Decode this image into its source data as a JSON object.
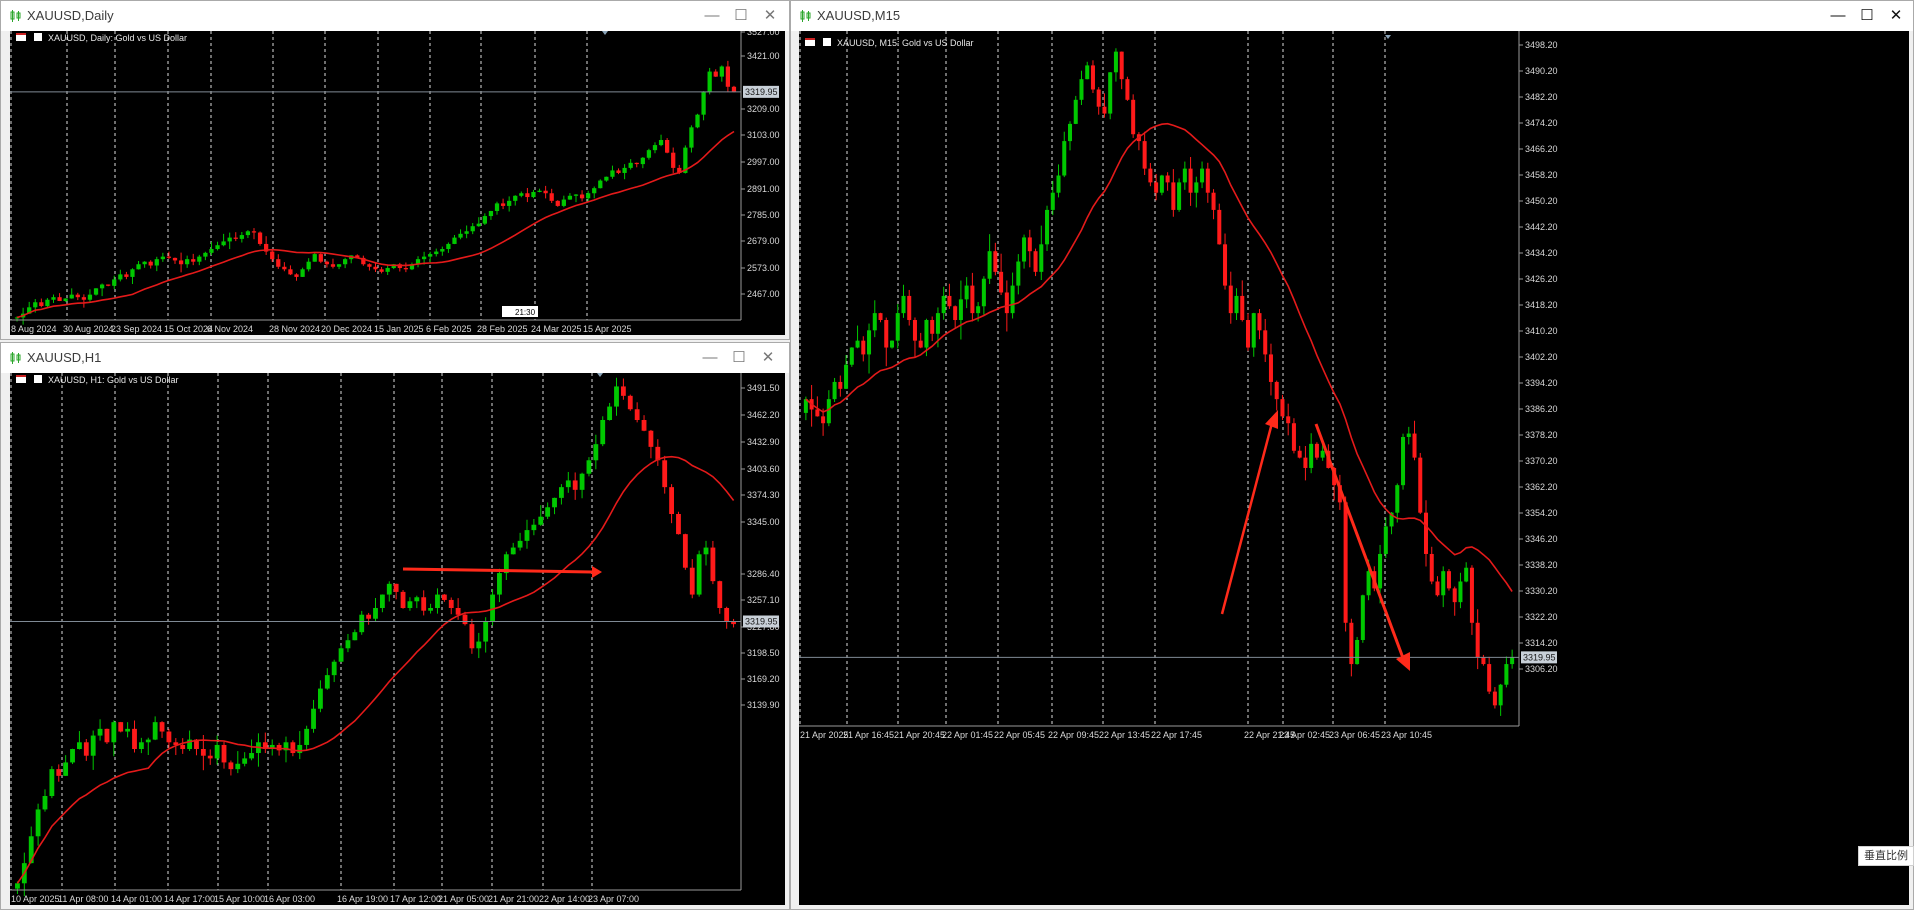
{
  "colors": {
    "up": "#00c800",
    "down": "#ff1a1a",
    "ma": "#e41a1a",
    "grid": "#dddddd",
    "axis": "#9a9a9a",
    "arrow": "#ff2a1a",
    "bid_line": "#7f8a95"
  },
  "windows": {
    "daily": {
      "title": "XAUUSD,Daily",
      "chart_label": "XAUUSD, Daily:  Gold vs US Dollar",
      "price_ticks": [
        "3527.00",
        "3421.00",
        "3209.00",
        "3103.00",
        "2997.00",
        "2891.00",
        "2785.00",
        "2679.00",
        "2573.00",
        "2467.00"
      ],
      "current_price": "3319.95",
      "time_labels": [
        "8 Aug 2024",
        "30 Aug 2024",
        "23 Sep 2024",
        "15 Oct 2024",
        "6 Nov 2024",
        "28 Nov 2024",
        "20 Dec 2024",
        "15 Jan 2025",
        "6 Feb 2025",
        "28 Feb 2025",
        "24 Mar 2025",
        "15 Apr 2025"
      ],
      "countdown": "21:30"
    },
    "h1": {
      "title": "XAUUSD,H1",
      "chart_label": "XAUUSD, H1:  Gold vs US Dollar",
      "price_ticks": [
        "3491.50",
        "3462.20",
        "3432.90",
        "3403.60",
        "3374.30",
        "3345.00",
        "3286.40",
        "3257.10",
        "3227.80",
        "3198.50",
        "3169.20",
        "3139.90"
      ],
      "current_price": "3319.95",
      "time_labels": [
        "10 Apr 2025",
        "11 Apr 08:00",
        "14 Apr 01:00",
        "14 Apr 17:00",
        "15 Apr 10:00",
        "16 Apr 03:00",
        "16 Apr 19:00",
        "17 Apr 12:00",
        "21 Apr 05:00",
        "21 Apr 21:00",
        "22 Apr 14:00",
        "23 Apr 07:00"
      ]
    },
    "m15": {
      "title": "XAUUSD,M15",
      "chart_label": "XAUUSD, M15:  Gold vs US Dollar",
      "price_ticks": [
        "3498.20",
        "3490.20",
        "3482.20",
        "3474.20",
        "3466.20",
        "3458.20",
        "3450.20",
        "3442.20",
        "3434.20",
        "3426.20",
        "3418.20",
        "3410.20",
        "3402.20",
        "3394.20",
        "3386.20",
        "3378.20",
        "3370.20",
        "3362.20",
        "3354.20",
        "3346.20",
        "3338.20",
        "3330.20",
        "3322.20",
        "3314.20",
        "3306.20"
      ],
      "current_price": "3319.95",
      "time_labels": [
        "21 Apr 2025",
        "21 Apr 16:45",
        "21 Apr 20:45",
        "22 Apr 01:45",
        "22 Apr 05:45",
        "22 Apr 09:45",
        "22 Apr 13:45",
        "22 Apr 17:45",
        "22 Apr 21:45",
        "23 Apr 02:45",
        "23 Apr 06:45",
        "23 Apr 10:45"
      ],
      "scale_button": "垂直比例"
    }
  },
  "series": {
    "daily": {
      "ylim": [
        2420,
        3560
      ],
      "ma_period": 20,
      "closes": [
        2430,
        2445,
        2470,
        2490,
        2475,
        2500,
        2510,
        2495,
        2505,
        2520,
        2510,
        2500,
        2520,
        2545,
        2560,
        2555,
        2580,
        2600,
        2590,
        2620,
        2640,
        2650,
        2635,
        2660,
        2670,
        2665,
        2655,
        2640,
        2660,
        2650,
        2670,
        2685,
        2700,
        2715,
        2730,
        2745,
        2740,
        2755,
        2770,
        2765,
        2720,
        2690,
        2660,
        2630,
        2620,
        2600,
        2590,
        2620,
        2650,
        2680,
        2650,
        2640,
        2630,
        2640,
        2660,
        2675,
        2665,
        2640,
        2630,
        2620,
        2610,
        2625,
        2640,
        2625,
        2620,
        2640,
        2660,
        2670,
        2680,
        2690,
        2700,
        2720,
        2745,
        2760,
        2770,
        2790,
        2800,
        2830,
        2850,
        2880,
        2870,
        2890,
        2910,
        2920,
        2905,
        2925,
        2930,
        2920,
        2890,
        2870,
        2895,
        2910,
        2915,
        2900,
        2920,
        2940,
        2970,
        2985,
        3010,
        3000,
        3020,
        3040,
        3035,
        3060,
        3090,
        3110,
        3130,
        3080,
        3020,
        3000,
        3100,
        3180,
        3230,
        3320,
        3400,
        3380,
        3420,
        3340,
        3320
      ]
    },
    "h1": {
      "ylim": [
        3120,
        3505
      ],
      "ma_period": 20,
      "closes": [
        3125,
        3140,
        3160,
        3180,
        3190,
        3210,
        3205,
        3215,
        3225,
        3230,
        3220,
        3235,
        3240,
        3230,
        3245,
        3238,
        3240,
        3225,
        3230,
        3232,
        3245,
        3238,
        3230,
        3228,
        3225,
        3232,
        3225,
        3220,
        3218,
        3228,
        3215,
        3210,
        3214,
        3218,
        3222,
        3230,
        3225,
        3228,
        3224,
        3230,
        3222,
        3228,
        3240,
        3255,
        3270,
        3280,
        3290,
        3300,
        3306,
        3312,
        3325,
        3322,
        3330,
        3340,
        3348,
        3342,
        3330,
        3335,
        3338,
        3328,
        3330,
        3340,
        3336,
        3330,
        3325,
        3318,
        3300,
        3305,
        3320,
        3340,
        3356,
        3370,
        3375,
        3380,
        3388,
        3392,
        3398,
        3405,
        3412,
        3420,
        3425,
        3418,
        3430,
        3440,
        3452,
        3470,
        3480,
        3495,
        3488,
        3478,
        3470,
        3462,
        3450,
        3440,
        3420,
        3400,
        3385,
        3360,
        3340,
        3370,
        3375,
        3350,
        3330,
        3320,
        3318
      ]
    },
    "m15": {
      "ylim": [
        3300,
        3502
      ],
      "ma_period": 20,
      "closes": [
        3395,
        3392,
        3390,
        3388,
        3395,
        3400,
        3398,
        3405,
        3410,
        3412,
        3408,
        3415,
        3420,
        3418,
        3410,
        3412,
        3420,
        3425,
        3418,
        3412,
        3410,
        3418,
        3414,
        3420,
        3425,
        3422,
        3418,
        3424,
        3428,
        3420,
        3422,
        3430,
        3438,
        3432,
        3426,
        3420,
        3428,
        3435,
        3442,
        3438,
        3432,
        3440,
        3450,
        3455,
        3460,
        3470,
        3475,
        3482,
        3488,
        3492,
        3485,
        3480,
        3478,
        3490,
        3496,
        3488,
        3482,
        3472,
        3470,
        3462,
        3458,
        3455,
        3460,
        3458,
        3450,
        3458,
        3462,
        3455,
        3458,
        3462,
        3455,
        3450,
        3440,
        3428,
        3420,
        3425,
        3418,
        3410,
        3420,
        3415,
        3408,
        3400,
        3395,
        3390,
        3388,
        3380,
        3378,
        3375,
        3382,
        3378,
        3380,
        3375,
        3370,
        3365,
        3330,
        3318,
        3325,
        3338,
        3345,
        3340,
        3350,
        3358,
        3362,
        3370,
        3384,
        3385,
        3378,
        3362,
        3350,
        3342,
        3338,
        3345,
        3340,
        3336,
        3342,
        3346,
        3330,
        3320,
        3318,
        3310,
        3306,
        3312,
        3318,
        3320
      ]
    }
  }
}
